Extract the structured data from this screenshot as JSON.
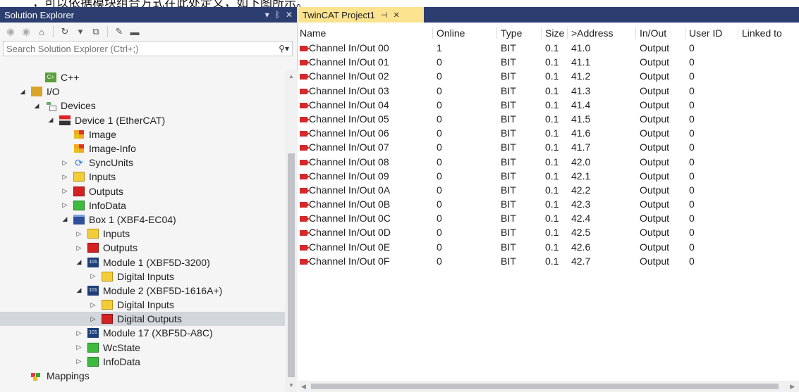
{
  "banner_text": "，可以依据模块组合方式在此处定义，如下图所示。",
  "explorer": {
    "title": "Solution Explorer",
    "search_placeholder": "Search Solution Explorer (Ctrl+;)",
    "tree": [
      {
        "label": "C++",
        "icon": "cpp-project-icon",
        "expander": "",
        "level": 2
      },
      {
        "label": "I/O",
        "icon": "io-folder-icon",
        "expander": "expanded",
        "level": 1
      },
      {
        "label": "Devices",
        "icon": "devices-icon",
        "expander": "expanded",
        "level": 2
      },
      {
        "label": "Device 1 (EtherCAT)",
        "icon": "ethercat-device-icon",
        "expander": "expanded",
        "level": 3
      },
      {
        "label": "Image",
        "icon": "image-icon",
        "expander": "",
        "level": 4
      },
      {
        "label": "Image-Info",
        "icon": "image-icon",
        "expander": "",
        "level": 4
      },
      {
        "label": "SyncUnits",
        "icon": "sync-icon",
        "expander": "collapsed",
        "level": 4
      },
      {
        "label": "Inputs",
        "icon": "inputs-icon",
        "expander": "collapsed",
        "level": 4
      },
      {
        "label": "Outputs",
        "icon": "outputs-icon",
        "expander": "collapsed",
        "level": 4
      },
      {
        "label": "InfoData",
        "icon": "infodata-icon",
        "expander": "collapsed",
        "level": 4
      },
      {
        "label": "Box 1 (XBF4-EC04)",
        "icon": "box-icon",
        "expander": "expanded",
        "level": 4
      },
      {
        "label": "Inputs",
        "icon": "inputs-icon",
        "expander": "collapsed",
        "level": 5
      },
      {
        "label": "Outputs",
        "icon": "outputs-icon",
        "expander": "collapsed",
        "level": 5
      },
      {
        "label": "Module 1 (XBF5D-3200)",
        "icon": "module-icon",
        "expander": "expanded",
        "level": 5
      },
      {
        "label": "Digital Inputs",
        "icon": "inputs-icon",
        "expander": "collapsed",
        "level": 6
      },
      {
        "label": "Module 2 (XBF5D-1616A+)",
        "icon": "module-icon",
        "expander": "expanded",
        "level": 5
      },
      {
        "label": "Digital Inputs",
        "icon": "inputs-icon",
        "expander": "collapsed",
        "level": 6
      },
      {
        "label": "Digital Outputs",
        "icon": "outputs-icon",
        "expander": "collapsed",
        "level": 6,
        "selected": true
      },
      {
        "label": "Module 17 (XBF5D-A8C)",
        "icon": "module-icon",
        "expander": "collapsed",
        "level": 5
      },
      {
        "label": "WcState",
        "icon": "wcstate-icon",
        "expander": "collapsed",
        "level": 5
      },
      {
        "label": "InfoData",
        "icon": "infodata-icon",
        "expander": "collapsed",
        "level": 5
      },
      {
        "label": "Mappings",
        "icon": "mappings-icon",
        "expander": "",
        "level": 1
      }
    ]
  },
  "document": {
    "tab_title": "TwinCAT Project1",
    "columns": [
      "Name",
      "Online",
      "Type",
      "Size",
      ">Address",
      "In/Out",
      "User ID",
      "Linked to"
    ],
    "rows": [
      {
        "name": "Channel In/Out 00",
        "online": "1",
        "type": "BIT",
        "size": "0.1",
        "address": "41.0",
        "inout": "Output",
        "userid": "0",
        "linked": ""
      },
      {
        "name": "Channel In/Out 01",
        "online": "0",
        "type": "BIT",
        "size": "0.1",
        "address": "41.1",
        "inout": "Output",
        "userid": "0",
        "linked": ""
      },
      {
        "name": "Channel In/Out 02",
        "online": "0",
        "type": "BIT",
        "size": "0.1",
        "address": "41.2",
        "inout": "Output",
        "userid": "0",
        "linked": ""
      },
      {
        "name": "Channel In/Out 03",
        "online": "0",
        "type": "BIT",
        "size": "0.1",
        "address": "41.3",
        "inout": "Output",
        "userid": "0",
        "linked": ""
      },
      {
        "name": "Channel In/Out 04",
        "online": "0",
        "type": "BIT",
        "size": "0.1",
        "address": "41.4",
        "inout": "Output",
        "userid": "0",
        "linked": ""
      },
      {
        "name": "Channel In/Out 05",
        "online": "0",
        "type": "BIT",
        "size": "0.1",
        "address": "41.5",
        "inout": "Output",
        "userid": "0",
        "linked": ""
      },
      {
        "name": "Channel In/Out 06",
        "online": "0",
        "type": "BIT",
        "size": "0.1",
        "address": "41.6",
        "inout": "Output",
        "userid": "0",
        "linked": ""
      },
      {
        "name": "Channel In/Out 07",
        "online": "0",
        "type": "BIT",
        "size": "0.1",
        "address": "41.7",
        "inout": "Output",
        "userid": "0",
        "linked": ""
      },
      {
        "name": "Channel In/Out 08",
        "online": "0",
        "type": "BIT",
        "size": "0.1",
        "address": "42.0",
        "inout": "Output",
        "userid": "0",
        "linked": ""
      },
      {
        "name": "Channel In/Out 09",
        "online": "0",
        "type": "BIT",
        "size": "0.1",
        "address": "42.1",
        "inout": "Output",
        "userid": "0",
        "linked": ""
      },
      {
        "name": "Channel In/Out 0A",
        "online": "0",
        "type": "BIT",
        "size": "0.1",
        "address": "42.2",
        "inout": "Output",
        "userid": "0",
        "linked": ""
      },
      {
        "name": "Channel In/Out 0B",
        "online": "0",
        "type": "BIT",
        "size": "0.1",
        "address": "42.3",
        "inout": "Output",
        "userid": "0",
        "linked": ""
      },
      {
        "name": "Channel In/Out 0C",
        "online": "0",
        "type": "BIT",
        "size": "0.1",
        "address": "42.4",
        "inout": "Output",
        "userid": "0",
        "linked": ""
      },
      {
        "name": "Channel In/Out 0D",
        "online": "0",
        "type": "BIT",
        "size": "0.1",
        "address": "42.5",
        "inout": "Output",
        "userid": "0",
        "linked": ""
      },
      {
        "name": "Channel In/Out 0E",
        "online": "0",
        "type": "BIT",
        "size": "0.1",
        "address": "42.6",
        "inout": "Output",
        "userid": "0",
        "linked": ""
      },
      {
        "name": "Channel In/Out 0F",
        "online": "0",
        "type": "BIT",
        "size": "0.1",
        "address": "42.7",
        "inout": "Output",
        "userid": "0",
        "linked": ""
      }
    ]
  },
  "colors": {
    "title_bar": "#2c3e6f",
    "active_tab": "#fbe38f",
    "selection": "#d3d6db",
    "output_red": "#d42222",
    "input_yellow": "#f3cc3a",
    "status_green": "#3cbb3c"
  }
}
